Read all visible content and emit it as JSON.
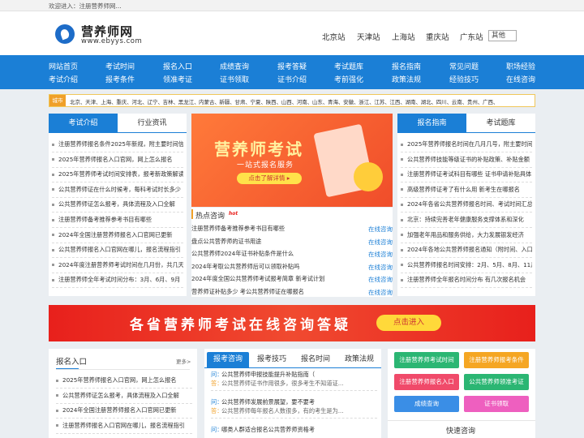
{
  "topbar": {
    "welcome": "欢迎进入：注册营养师网..."
  },
  "header": {
    "title": "营养师网",
    "domain": "www.ebyys.com",
    "stations": [
      "北京站",
      "天津站",
      "上海站",
      "重庆站",
      "广东站"
    ],
    "other_select": "其他"
  },
  "nav": {
    "row1": [
      "网站首页",
      "考试时间",
      "报名入口",
      "成绩查询",
      "报考答疑",
      "考试题库",
      "报名指南",
      "常见问题",
      "职场经验"
    ],
    "row2": [
      "考试介绍",
      "报考条件",
      "领准考证",
      "证书领取",
      "证书介绍",
      "考前强化",
      "政策法规",
      "经验技巧",
      "在线咨询"
    ]
  },
  "citybar": {
    "label": "城市",
    "cities": [
      "北京、",
      "天津、",
      "上海、",
      "重庆、",
      "河北、",
      "辽宁、",
      "吉林、",
      "黑龙江、",
      "内蒙古、",
      "新疆、",
      "甘肃、",
      "宁夏、",
      "陕西、",
      "山西、",
      "河南、",
      "山东、",
      "青海、",
      "安徽、",
      "浙江、",
      "江苏、",
      "江西、",
      "湖南、",
      "湖北、",
      "四川、",
      "云南、",
      "贵州、",
      "广西、"
    ]
  },
  "left_panel": {
    "tabs": [
      "考试介绍",
      "行业资讯"
    ],
    "items": [
      "注册营养师报名条件2025年新规，附主要时间信息",
      "2025年营养师报名入口官网，网上怎么报名",
      "2025年营养师考试时间安排表，报考新政策解读",
      "公共营养师证在什么时候考，每科考试时长多少",
      "公共营养师证怎么报考，具体流程及入口全解",
      "注册营养师备考推荐参考书目有哪些",
      "2024年全国注册营养师报名入口官网已更新",
      "公共营养师报名入口官网在哪儿，报名流程指引",
      "2024年度注册营养师考试时间在几月份，共几天",
      "注册营养师全年考试时间分布：3月、6月、9月"
    ]
  },
  "center_banner": {
    "title": "营养师考试",
    "subtitle": "一站式报名服务",
    "button": "点击了解详情 ▸"
  },
  "hot": {
    "title": "热点咨询",
    "badge": "hot",
    "items": [
      {
        "text": "注册营养师备考推荐参考书目有哪些",
        "link": "在线咨询"
      },
      {
        "text": "盘点公共营养师的证书用途",
        "link": "在线咨询"
      },
      {
        "text": "公共营养师2024年证书补贴条件是什么",
        "link": "在线咨询"
      },
      {
        "text": "2024年考取公共营养师后可以领取补贴吗",
        "link": "在线咨询"
      },
      {
        "text": "2024年度全国公共营养师考试报考简章 新考试计划",
        "link": "在线咨询"
      },
      {
        "text": "营养师证补贴多少 考公共营养师证在哪报名",
        "link": "在线咨询"
      }
    ]
  },
  "right_panel": {
    "tabs": [
      "报名指南",
      "考试题库"
    ],
    "items": [
      "2025年营养师报名时间在几月几号，附主要时间",
      "公共营养师技能等级证书的补贴政策、补贴金额",
      "注册营养师证考试科目有哪些 证书申请补贴具体",
      "高级营养师证考了有什么用 新考生在哪报名",
      "2024年各省公共营养师报名时间、考试时间汇总",
      "北京：持续完善老年健康服务支撑体系和深化",
      "加强老年用品和服务供给，大力发展银发经济",
      "2024年各地公共营养师报名通知（附时间、入口）",
      "公共营养师报名时间安排：2月、5月、8月、11月",
      "注册营养师全年报名时间分布 有几次报名机会"
    ]
  },
  "big_banner": {
    "text": "各省营养师考试在线咨询答疑",
    "button": "点击进入"
  },
  "signup": {
    "title": "报名入口",
    "more": "更多>",
    "items": [
      "2025年营养师报名入口官网，网上怎么报名",
      "公共营养师证怎么报考，具体流程及入口全解",
      "2024年全国注册营养师报名入口官网已更新",
      "注册营养师报名入口官网在哪儿，报名流程指引"
    ]
  },
  "qa": {
    "tabs": [
      "报考咨询",
      "报考技巧",
      "报名时间",
      "政策法规"
    ],
    "pairs": [
      {
        "q": "问：",
        "q_text": "公共营养师申报技能提升补贴指南（",
        "a": "答：",
        "a_text": "公共营养师证书作用很多，很多考生不知道证..."
      },
      {
        "q": "问：",
        "q_text": "公共营养师发展前景展望，要不要考",
        "a": "答：",
        "a_text": "公共营养师每年报名人数很多，有的考生是为..."
      },
      {
        "q": "问：",
        "q_text": "哪类人群适合报名公共营养师资格考",
        "a": "",
        "a_text": ""
      }
    ]
  },
  "quick": {
    "buttons": [
      {
        "label": "注册营养师考试时间",
        "color": "#2bb673"
      },
      {
        "label": "注册营养师报考条件",
        "color": "#f5a623"
      },
      {
        "label": "注册营养师报名入口",
        "color": "#f04a6a"
      },
      {
        "label": "公共营养师领准考证",
        "color": "#2bb673"
      },
      {
        "label": "成绩查询",
        "color": "#3a8ee6"
      },
      {
        "label": "证书领取",
        "color": "#ee5fbf"
      }
    ],
    "consult_title": "快速咨询"
  }
}
